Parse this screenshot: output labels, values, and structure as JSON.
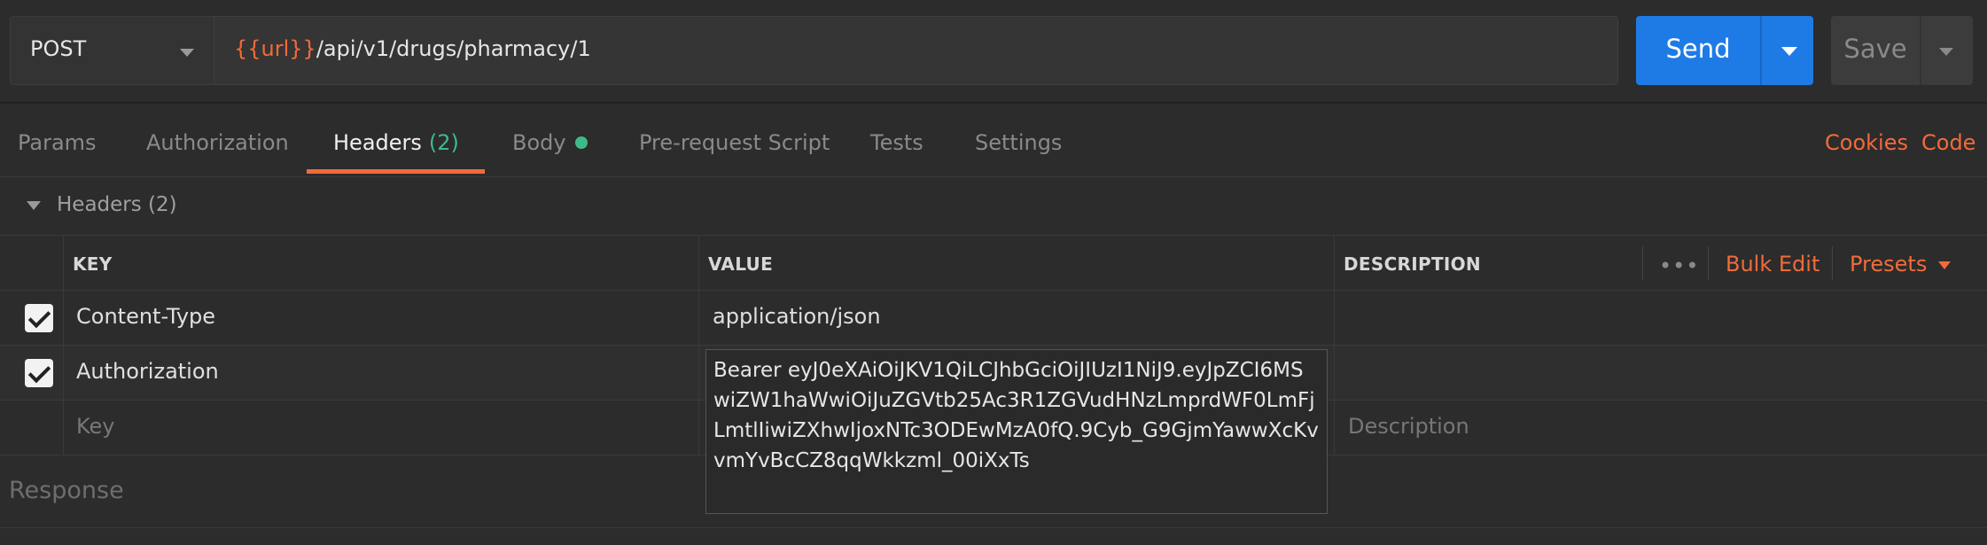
{
  "request": {
    "method": "POST",
    "url_variable": "{{url}}",
    "url_path": "/api/v1/drugs/pharmacy/1",
    "send_label": "Send",
    "save_label": "Save"
  },
  "tabs": [
    {
      "label": "Params"
    },
    {
      "label": "Authorization"
    },
    {
      "label": "Headers",
      "count": "(2)",
      "active": true
    },
    {
      "label": "Body",
      "indicator": "dot"
    },
    {
      "label": "Pre-request Script"
    },
    {
      "label": "Tests"
    },
    {
      "label": "Settings"
    }
  ],
  "tab_links": {
    "cookies": "Cookies",
    "code": "Code"
  },
  "headers_section": {
    "title": "Headers",
    "count": "(2)"
  },
  "table": {
    "columns": {
      "key": "KEY",
      "value": "VALUE",
      "description": "DESCRIPTION"
    },
    "actions": {
      "more": "•••",
      "bulk_edit": "Bulk Edit",
      "presets": "Presets"
    },
    "rows": [
      {
        "checked": true,
        "key": "Content-Type",
        "value": "application/json",
        "description": ""
      },
      {
        "checked": true,
        "key": "Authorization",
        "value": "Bearer eyJ0eXAiOiJKV1QiLCJhbGciOiJIUzI1NiJ9.eyJpZCI6MSwiZW1haWwiOiJuZGVtb25Ac3R1ZGVudHNzLmprdWF0LmFjLmtlIiwiZXhwIjoxNTc3ODEwMzA0fQ.9Cyb_G9GjmYawwXcKvvmYvBcCZ8qqWkkzml_00iXxTs",
        "description": ""
      }
    ],
    "placeholder": {
      "key": "Key",
      "description": "Description"
    }
  },
  "response": {
    "label": "Response"
  },
  "colors": {
    "accent": "#f26b3a",
    "primary": "#1e7be6",
    "success": "#3dba8a",
    "background": "#2c2c2c"
  }
}
